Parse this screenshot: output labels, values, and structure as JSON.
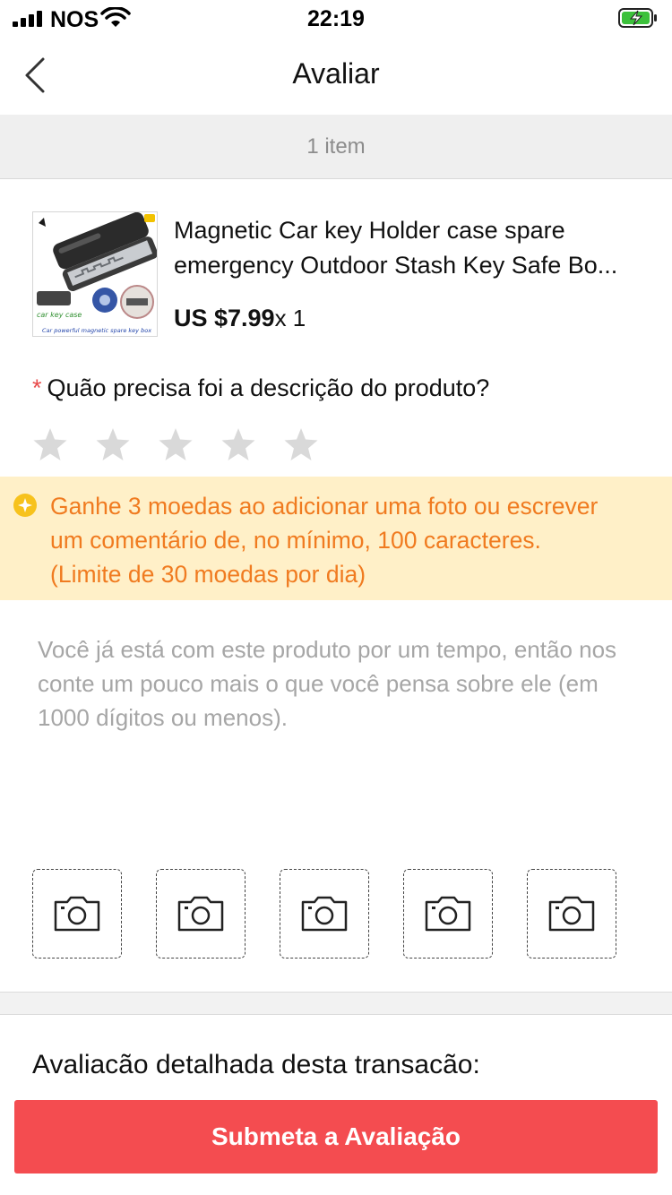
{
  "status_bar": {
    "carrier": "NOS",
    "time": "22:19"
  },
  "header": {
    "title": "Avaliar"
  },
  "items_summary": {
    "text": "1 item"
  },
  "product": {
    "title_line1": "Magnetic Car key Holder case spare",
    "title_line2": "emergency Outdoor Stash Key Safe Bo...",
    "price": "US $7.99",
    "quantity": "x 1",
    "thumb_badge": "car key case",
    "thumb_caption": "Car powerful magnetic spare key box"
  },
  "rating": {
    "required_mark": "*",
    "question": "Quão precisa foi a descrição do produto?",
    "stars": 5,
    "value": 0
  },
  "coins_banner": {
    "line1": "Ganhe 3 moedas ao adicionar uma foto ou escrever",
    "line2": "um comentário de, no mínimo, 100 caracteres.",
    "line3": "(Limite de 30 moedas por dia)"
  },
  "comment": {
    "placeholder": "Você já está com este produto por um tempo, então nos conte um pouco mais o que você pensa sobre ele (em 1000 dígitos ou menos).",
    "value": ""
  },
  "photos": {
    "slots": 5
  },
  "detail_section": {
    "title": "Avaliacão detalhada desta transacão:"
  },
  "footer": {
    "submit_label": "Submeta a Avaliação"
  },
  "colors": {
    "accent": "#f44c50",
    "coins_bg": "#fff0c8",
    "coins_text": "#f07b20",
    "star_empty": "#d9d9d9"
  }
}
